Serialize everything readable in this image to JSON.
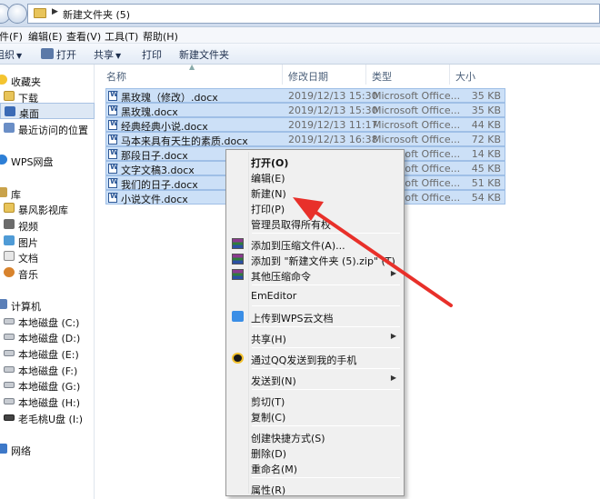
{
  "address": {
    "path": "新建文件夹 (5)"
  },
  "menubar": [
    {
      "label": "件(F)"
    },
    {
      "label": "编辑(E)"
    },
    {
      "label": "查看(V)"
    },
    {
      "label": "工具(T)"
    },
    {
      "label": "帮助(H)"
    }
  ],
  "toolbar": {
    "organize": "组织",
    "open": "打开",
    "share": "共享",
    "print": "打印",
    "new_folder": "新建文件夹"
  },
  "sidebar": {
    "items": [
      {
        "label": "收藏夹",
        "icon": "star-icon"
      },
      {
        "label": "下载",
        "icon": "folder-icon"
      },
      {
        "label": "桌面",
        "icon": "desktop-icon"
      },
      {
        "label": "最近访问的位置",
        "icon": "recent-places-icon"
      },
      {
        "label": "WPS网盘",
        "icon": "wps-cloud-icon"
      },
      {
        "label": "库",
        "icon": "library-icon"
      },
      {
        "label": "暴风影视库",
        "icon": "folder-icon"
      },
      {
        "label": "视频",
        "icon": "video-icon"
      },
      {
        "label": "图片",
        "icon": "pictures-icon"
      },
      {
        "label": "文档",
        "icon": "documents-icon"
      },
      {
        "label": "音乐",
        "icon": "music-icon"
      },
      {
        "label": "计算机",
        "icon": "computer-icon"
      },
      {
        "label": "本地磁盘 (C:)",
        "icon": "disk-icon"
      },
      {
        "label": "本地磁盘 (D:)",
        "icon": "disk-icon"
      },
      {
        "label": "本地磁盘 (E:)",
        "icon": "disk-icon"
      },
      {
        "label": "本地磁盘 (F:)",
        "icon": "disk-icon"
      },
      {
        "label": "本地磁盘 (G:)",
        "icon": "disk-icon"
      },
      {
        "label": "本地磁盘 (H:)",
        "icon": "disk-icon"
      },
      {
        "label": "老毛桃U盘 (I:)",
        "icon": "usb-drive-icon"
      },
      {
        "label": "网络",
        "icon": "network-icon"
      }
    ]
  },
  "columns": {
    "name": "名称",
    "date": "修改日期",
    "type": "类型",
    "size": "大小"
  },
  "files": [
    {
      "name": "黑玫瑰（修改）.docx",
      "date": "2019/12/13 15:30",
      "type": "Microsoft Office...",
      "size": "35 KB"
    },
    {
      "name": "黑玫瑰.docx",
      "date": "2019/12/13 15:30",
      "type": "Microsoft Office...",
      "size": "35 KB"
    },
    {
      "name": "经典经典小说.docx",
      "date": "2019/12/13 11:17",
      "type": "Microsoft Office...",
      "size": "44 KB"
    },
    {
      "name": "马本来具有天生的素质.docx",
      "date": "2019/12/13 16:38",
      "type": "Microsoft Office...",
      "size": "72 KB"
    },
    {
      "name": "那段日子.docx",
      "date": "",
      "type": "Microsoft Office...",
      "size": "14 KB"
    },
    {
      "name": "文字文稿3.docx",
      "date": "",
      "type": "Microsoft Office...",
      "size": "45 KB"
    },
    {
      "name": "我们的日子.docx",
      "date": "",
      "type": "Microsoft Office...",
      "size": "51 KB"
    },
    {
      "name": "小说文件.docx",
      "date": "",
      "type": "Microsoft Office...",
      "size": "54 KB"
    }
  ],
  "context_menu": {
    "items": [
      {
        "label": "打开(O)"
      },
      {
        "label": "编辑(E)"
      },
      {
        "label": "新建(N)"
      },
      {
        "label": "打印(P)"
      },
      {
        "label": "管理员取得所有权"
      },
      {
        "label": "添加到压缩文件(A)..."
      },
      {
        "label": "添加到 \"新建文件夹 (5).zip\" (T)"
      },
      {
        "label": "其他压缩命令"
      },
      {
        "label": "EmEditor"
      },
      {
        "label": "上传到WPS云文档"
      },
      {
        "label": "共享(H)"
      },
      {
        "label": "通过QQ发送到我的手机"
      },
      {
        "label": "发送到(N)"
      },
      {
        "label": "剪切(T)"
      },
      {
        "label": "复制(C)"
      },
      {
        "label": "创建快捷方式(S)"
      },
      {
        "label": "删除(D)"
      },
      {
        "label": "重命名(M)"
      },
      {
        "label": "属性(R)"
      }
    ]
  },
  "colors": {
    "selection": "#cce0f7",
    "annotation_arrow": "#e8302a"
  }
}
